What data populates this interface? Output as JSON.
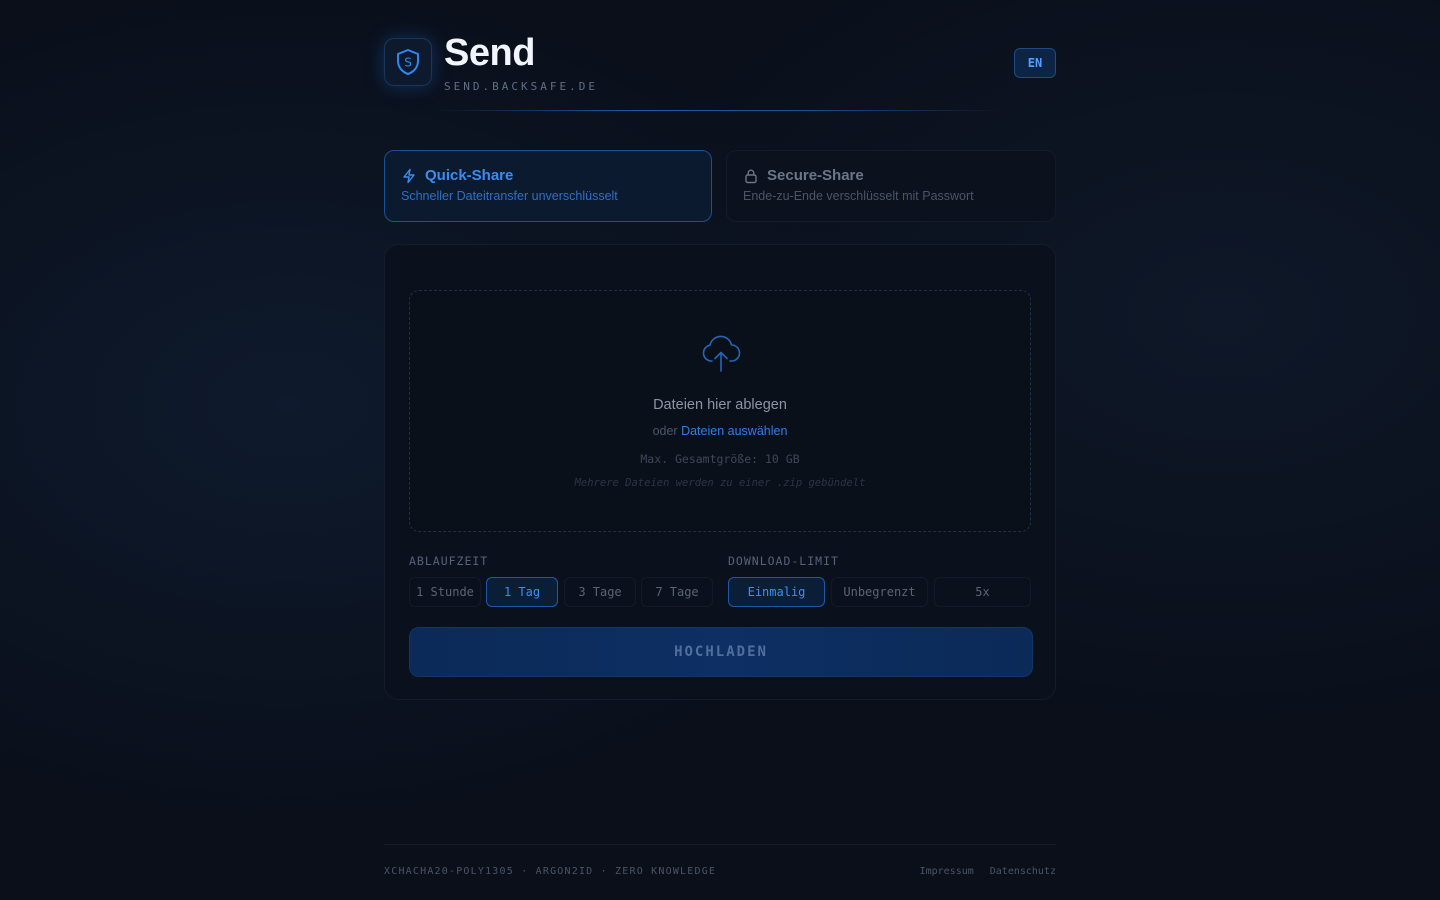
{
  "header": {
    "title": "Send",
    "subtitle": "SEND.BACKSAFE.DE",
    "lang": "EN"
  },
  "modes": {
    "quick": {
      "title": "Quick-Share",
      "desc": "Schneller Dateitransfer unverschlüsselt",
      "icon": "lightning-icon"
    },
    "secure": {
      "title": "Secure-Share",
      "desc": "Ende-zu-Ende verschlüsselt mit Passwort",
      "icon": "lock-icon"
    }
  },
  "dropzone": {
    "title": "Dateien hier ablegen",
    "or": "oder ",
    "link": "Dateien auswählen",
    "max": "Max. Gesamtgröße: 10 GB",
    "note": "Mehrere Dateien werden zu einer .zip gebündelt"
  },
  "expiry": {
    "label": "ABLAUFZEIT",
    "options": [
      "1 Stunde",
      "1 Tag",
      "3 Tage",
      "7 Tage"
    ],
    "selected": "1 Tag"
  },
  "limit": {
    "label": "DOWNLOAD-LIMIT",
    "options": [
      "Einmalig",
      "Unbegrenzt",
      "5x"
    ],
    "selected": "Einmalig"
  },
  "submit": "HOCHLADEN",
  "footer": {
    "tech": "XCHACHA20-POLY1305 · ARGON2ID · ZERO KNOWLEDGE",
    "links": [
      "Impressum",
      "Datenschutz"
    ]
  },
  "colors": {
    "accent": "#3b8cf0",
    "background": "#0a0f1a"
  }
}
